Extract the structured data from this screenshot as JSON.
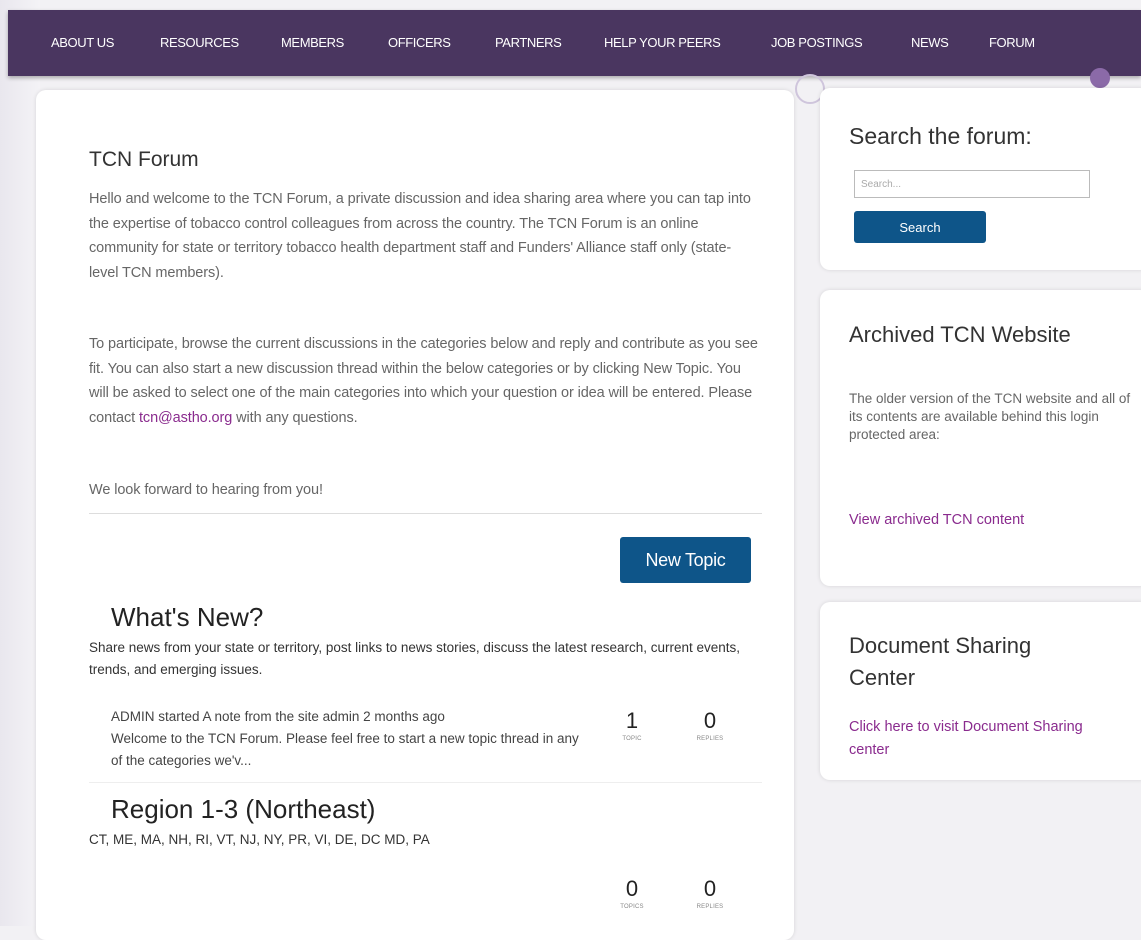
{
  "nav": {
    "items": [
      "ABOUT US",
      "RESOURCES",
      "MEMBERS",
      "OFFICERS",
      "PARTNERS",
      "HELP YOUR PEERS",
      "JOB POSTINGS",
      "NEWS",
      "FORUM"
    ]
  },
  "main": {
    "title": "TCN Forum",
    "intro": "Hello and welcome to the TCN Forum, a private discussion and idea sharing area where you can tap into the expertise of tobacco control colleagues from across the country. The TCN Forum is an online community for state or territory tobacco health department staff and Funders' Alliance staff only (state-level TCN members).",
    "participate_before": "To participate, browse the current discussions in the categories below and reply and contribute as you see fit. You can also start a new discussion thread within the below categories or by clicking New Topic. You will be asked to select one of the main categories into which your question or idea will be entered. Please contact ",
    "participate_email": "tcn@astho.org",
    "participate_after": " with any questions.",
    "closing": "We look forward to hearing from you!",
    "new_topic_label": "New Topic"
  },
  "categories": [
    {
      "title": "What's New?",
      "description": "Share news from your state or territory, post links to news stories, discuss the latest research, current events, trends, and emerging issues.",
      "latest_line1": "ADMIN started A note from the site admin 2 months ago",
      "latest_line2": "Welcome to the TCN Forum. Please feel free to start a new topic thread in any of the categories we'v...",
      "topics": "1",
      "topics_label": "TOPIC",
      "replies": "0",
      "replies_label": "REPLIES"
    },
    {
      "title": "Region 1-3 (Northeast)",
      "description": "CT, ME, MA, NH, RI, VT, NJ, NY, PR, VI, DE, DC MD, PA",
      "topics": "0",
      "topics_label": "TOPICS",
      "replies": "0",
      "replies_label": "REPLIES"
    }
  ],
  "sidebar": {
    "search": {
      "title": "Search the forum:",
      "placeholder": "Search...",
      "button_label": "Search"
    },
    "archive": {
      "title": "Archived TCN Website",
      "text": "The older version of the TCN website and all of its contents are available behind this login protected area:",
      "link": "View archived TCN content"
    },
    "docs": {
      "title": "Document Sharing Center",
      "link": "Click here to visit Document Sharing center"
    }
  },
  "colors": {
    "nav_bg": "#4a3660",
    "button_blue": "#0e5589",
    "link_purple": "#8a2b8e"
  }
}
